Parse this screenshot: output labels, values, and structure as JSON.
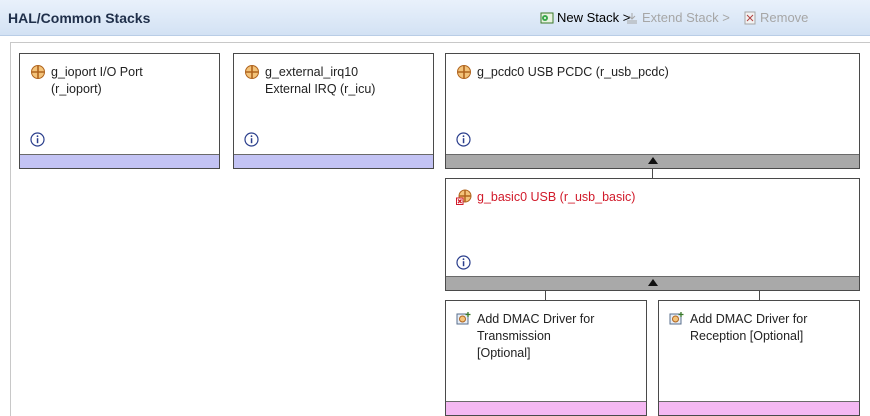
{
  "header": {
    "title": "HAL/Common Stacks"
  },
  "toolbar": {
    "new_stack": "New Stack >",
    "extend_stack": "Extend Stack >",
    "remove": "Remove"
  },
  "blocks": [
    {
      "line1": "g_ioport I/O Port",
      "line2": "(r_ioport)"
    },
    {
      "line1": "g_external_irq10",
      "line2": "External IRQ (r_icu)"
    },
    {
      "line1": "g_pcdc0 USB PCDC (r_usb_pcdc)"
    },
    {
      "line1": "g_basic0 USB (r_usb_basic)"
    },
    {
      "line1": "Add DMAC Driver for",
      "line2": "Transmission",
      "line3": "[Optional]"
    },
    {
      "line1": "Add DMAC Driver for",
      "line2": "Reception [Optional]"
    }
  ],
  "colors": {
    "header_bg": "#d3e2f4",
    "module_bar": "#c3c3f4",
    "optional_bar": "#f4b8f2",
    "dependency_bar": "#a9a9a9",
    "error_text": "#d11a2a"
  }
}
